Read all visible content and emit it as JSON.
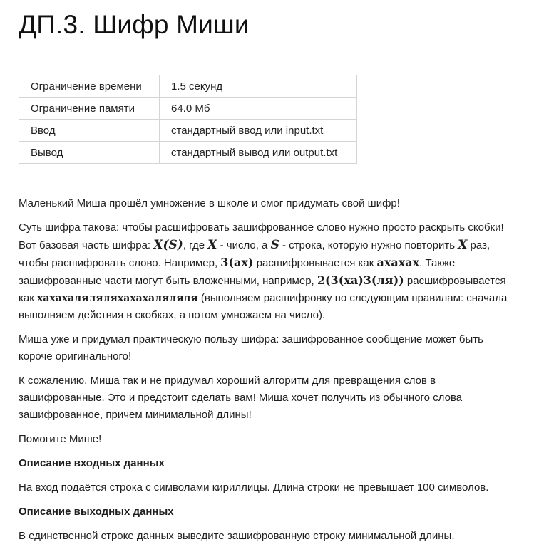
{
  "title": "ДП.3. Шифр Миши",
  "limits": [
    {
      "label": "Ограничение времени",
      "value": "1.5 секунд"
    },
    {
      "label": "Ограничение памяти",
      "value": "64.0 Мб"
    },
    {
      "label": "Ввод",
      "value": "стандартный ввод или input.txt"
    },
    {
      "label": "Вывод",
      "value": "стандартный вывод или output.txt"
    }
  ],
  "statement": {
    "intro": "Маленький Миша прошёл умножение в школе и смог придумать свой шифр!",
    "rule": {
      "t1": "Суть шифра такова: чтобы расшифровать зашифрованное слово нужно просто раскрыть скобки! Вот базовая часть шифра: ",
      "f1": "X(S)",
      "t2": ", где ",
      "f2": "X",
      "t3": " - число, а ",
      "f3": "S",
      "t4": " - строка, которую нужно повторить ",
      "f4": "X",
      "t5": " раз, чтобы расшифровать слово. Например, ",
      "f5": "3(ax)",
      "t6": " расшифровывается как ",
      "f6": "axaxax",
      "t7": ". Также зашифрованные части могут быть вложенными, например, ",
      "f7": "2(3(xa)3(ля))",
      "t8": " расшифровывается как ",
      "f8": "хахахаляляляхахахаляляля",
      "t9": " (выполняем расшифровку по следующим правилам: сначала выполняем действия в скобках, а потом умножаем на число)."
    },
    "usage": "Миша уже и придумал практическую пользу шифра: зашифрованное сообщение может быть короче оригинального!",
    "task": "К сожалению, Миша так и не придумал хороший алгоритм для превращения слов в зашифрованные. Это и предстоит сделать вам! Миша хочет получить из обычного слова зашифрованное, причем минимальной длины!",
    "help": "Помогите Мише!",
    "input_heading": "Описание входных данных",
    "input_text": "На вход подаётся строка с символами кириллицы. Длина строки не превышает 100 символов.",
    "output_heading": "Описание выходных данных",
    "output_text": "В единственной строке данных выведите зашифрованную строку минимальной длины."
  }
}
